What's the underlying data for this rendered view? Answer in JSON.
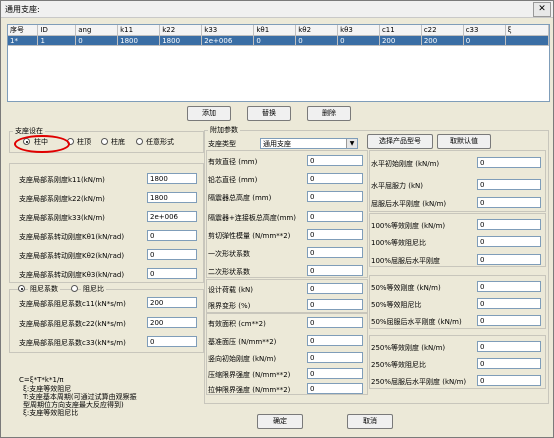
{
  "window": {
    "title": "通用支座:",
    "close": "✕"
  },
  "table": {
    "headers": [
      "序号",
      "ID",
      "ang",
      "k11",
      "k22",
      "k33",
      "kθ1",
      "kθ2",
      "kθ3",
      "c11",
      "c22",
      "c33",
      "ξ"
    ],
    "rows": [
      [
        "1*",
        "1",
        "0",
        "1800",
        "1800",
        "2e+006",
        "0",
        "0",
        "0",
        "200",
        "200",
        "0",
        ""
      ]
    ]
  },
  "buttons": {
    "add": "添加",
    "replace": "替换",
    "delete": "删除",
    "ok": "确定",
    "cancel": "取消",
    "select_product": "选择产品型号",
    "default_values": "取默认值"
  },
  "position_group": {
    "title": "支座设在",
    "options": [
      "柱中",
      "柱顶",
      "柱底",
      "任意形式"
    ],
    "selected": "柱中"
  },
  "stiffness": [
    {
      "label": "支座局部系刚度k11(kN/m)",
      "value": "1800"
    },
    {
      "label": "支座局部系刚度k22(kN/m)",
      "value": "1800"
    },
    {
      "label": "支座局部系刚度k33(kN/m)",
      "value": "2e+006"
    },
    {
      "label": "支座局部系转动刚度Kθ1(kN/rad)",
      "value": "0"
    },
    {
      "label": "支座局部系转动刚度Kθ2(kN/rad)",
      "value": "0"
    },
    {
      "label": "支座局部系转动刚度Kθ3(kN/rad)",
      "value": "0"
    }
  ],
  "damping_mode": {
    "options": [
      "阻尼系数",
      "阻尼比"
    ],
    "selected": "阻尼系数"
  },
  "damping": [
    {
      "label": "支座局部系阻尼系数c11(kN*s/m)",
      "value": "200"
    },
    {
      "label": "支座局部系阻尼系数c22(kN*s/m)",
      "value": "200"
    },
    {
      "label": "支座局部系阻尼系数c33(kN*s/m)",
      "value": "0"
    }
  ],
  "notes": [
    "C=ξ*T*k*1/π",
    "ξ:支座等效阻尼",
    "T:支座基本周期(可通过试算由观察振",
    "型周期位方向支座最大反应得到)",
    "ξ:支座等效阻尼比"
  ],
  "extra": {
    "title": "附加参数",
    "support_type_label": "支座类型",
    "support_type_value": "通用支座",
    "params1": [
      {
        "label": "有效直径 (mm)",
        "value": "0"
      },
      {
        "label": "铅芯直径 (mm)",
        "value": "0"
      },
      {
        "label": "隔震器总高度 (mm)",
        "value": "0"
      },
      {
        "label": "隔震器+连接板总高度(mm)",
        "value": "0"
      },
      {
        "label": "剪切弹性模量 (N/mm**2)",
        "value": "0"
      },
      {
        "label": "一次形状系数",
        "value": "0"
      },
      {
        "label": "二次形状系数",
        "value": "0"
      }
    ],
    "params2": [
      {
        "label": "设计荷载 (kN)",
        "value": "0"
      },
      {
        "label": "限界变形 (%)",
        "value": "0"
      }
    ],
    "params3": [
      {
        "label": "有效面积 (cm**2)",
        "value": "0"
      },
      {
        "label": "基准面压 (N/mm**2)",
        "value": "0"
      },
      {
        "label": "竖向初始刚度 (kN/m)",
        "value": "0"
      },
      {
        "label": "压缩限界强度 (N/mm**2)",
        "value": "0"
      },
      {
        "label": "拉伸限界强度 (N/mm**2)",
        "value": "0"
      }
    ],
    "right1": [
      {
        "label": "水平初始刚度 (kN/m)",
        "value": "0"
      },
      {
        "label": "水平屈服力 (kN)",
        "value": "0"
      },
      {
        "label": "屈服后水平刚度 (kN/m)",
        "value": "0"
      }
    ],
    "right2": [
      {
        "label": "100%等效刚度 (kN/m)",
        "value": "0"
      },
      {
        "label": "100%等效阻尼比",
        "value": "0"
      },
      {
        "label": "100%屈服后水平刚度",
        "value": "0"
      }
    ],
    "right3": [
      {
        "label": "50%等效刚度 (kN/m)",
        "value": "0"
      },
      {
        "label": "50%等效阻尼比",
        "value": "0"
      },
      {
        "label": "50%屈服后水平刚度 (kN/m)",
        "value": "0"
      }
    ],
    "right4": [
      {
        "label": "250%等效刚度 (kN/m)",
        "value": "0"
      },
      {
        "label": "250%等效阻尼比",
        "value": "0"
      },
      {
        "label": "250%屈服后水平刚度 (kN/m)",
        "value": "0"
      }
    ]
  }
}
